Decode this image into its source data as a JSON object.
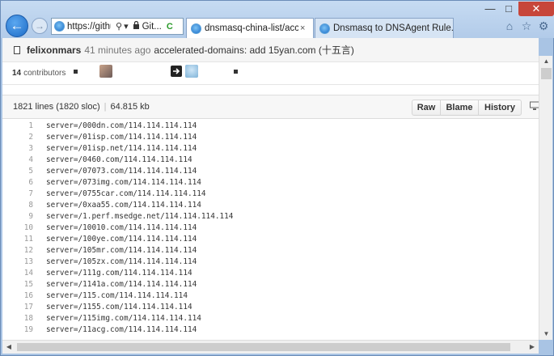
{
  "window": {
    "controls": {
      "minimize": "—",
      "maximize": "□",
      "close": "✕"
    }
  },
  "nav": {
    "back_glyph": "←",
    "forward_glyph": "→"
  },
  "address": {
    "url": "https://github.com",
    "search_glyph": "⚲",
    "dropdown_glyph": "▾",
    "lock_glyph": "🔒",
    "site": "Git...",
    "refresh_glyph": "C"
  },
  "tabs": [
    {
      "label": "dnsmasq-china-list/accel...",
      "close": "×"
    },
    {
      "label": "Dnsmasq to DNSAgent Rule...",
      "close": ""
    }
  ],
  "toolbar": {
    "home_glyph": "⌂",
    "favorites_glyph": "☆",
    "settings_glyph": "⚙"
  },
  "commit": {
    "author": "felixonmars",
    "ago": "41 minutes ago",
    "message": "accelerated-domains: add 15yan.com (十五言)"
  },
  "contributors": {
    "count": "14",
    "label": "contributors"
  },
  "file": {
    "lines": "1821 lines (1820 sloc)",
    "size": "64.815 kb",
    "buttons": {
      "raw": "Raw",
      "blame": "Blame",
      "history": "History"
    }
  },
  "code_lines": [
    {
      "n": "1",
      "text": "server=/000dn.com/114.114.114.114"
    },
    {
      "n": "2",
      "text": "server=/01isp.com/114.114.114.114"
    },
    {
      "n": "3",
      "text": "server=/01isp.net/114.114.114.114"
    },
    {
      "n": "4",
      "text": "server=/0460.com/114.114.114.114"
    },
    {
      "n": "5",
      "text": "server=/07073.com/114.114.114.114"
    },
    {
      "n": "6",
      "text": "server=/073img.com/114.114.114.114"
    },
    {
      "n": "7",
      "text": "server=/0755car.com/114.114.114.114"
    },
    {
      "n": "8",
      "text": "server=/0xaa55.com/114.114.114.114"
    },
    {
      "n": "9",
      "text": "server=/1.perf.msedge.net/114.114.114.114"
    },
    {
      "n": "10",
      "text": "server=/10010.com/114.114.114.114"
    },
    {
      "n": "11",
      "text": "server=/100ye.com/114.114.114.114"
    },
    {
      "n": "12",
      "text": "server=/105mr.com/114.114.114.114"
    },
    {
      "n": "13",
      "text": "server=/105zx.com/114.114.114.114"
    },
    {
      "n": "14",
      "text": "server=/111g.com/114.114.114.114"
    },
    {
      "n": "15",
      "text": "server=/1141a.com/114.114.114.114"
    },
    {
      "n": "16",
      "text": "server=/115.com/114.114.114.114"
    },
    {
      "n": "17",
      "text": "server=/1155.com/114.114.114.114"
    },
    {
      "n": "18",
      "text": "server=/115img.com/114.114.114.114"
    },
    {
      "n": "19",
      "text": "server=/11acg.com/114.114.114.114"
    }
  ],
  "scroll": {
    "up": "▲",
    "down": "▼",
    "left": "◀",
    "right": "▶"
  }
}
